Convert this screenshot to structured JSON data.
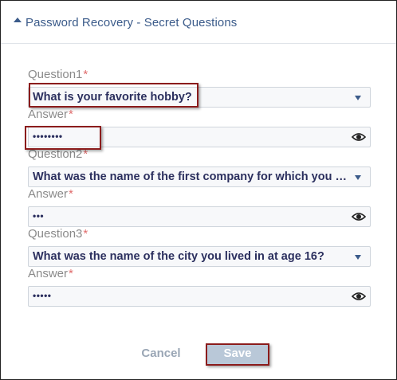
{
  "header": {
    "title": "Password Recovery - Secret Questions"
  },
  "form": {
    "required_mark": "*",
    "groups": [
      {
        "question_label": "Question1",
        "question_value": "What is your favorite hobby?",
        "answer_label": "Answer",
        "answer_masked": "••••••••"
      },
      {
        "question_label": "Question2",
        "question_value": "What was the name of the first company for which you …",
        "answer_label": "Answer",
        "answer_masked": "•••"
      },
      {
        "question_label": "Question3",
        "question_value": "What was the name of the city you lived in at age 16?",
        "answer_label": "Answer",
        "answer_masked": "•••••"
      }
    ]
  },
  "actions": {
    "cancel_label": "Cancel",
    "save_label": "Save"
  },
  "colors": {
    "accent": "#3b5b8a",
    "required": "#e06c6c",
    "annotation": "#8b1c1c",
    "save_bg": "#b9c8d8"
  },
  "icons": {
    "header_toggle": "caret-up-icon",
    "select_toggle": "chevron-down-icon",
    "reveal": "eye-icon"
  }
}
